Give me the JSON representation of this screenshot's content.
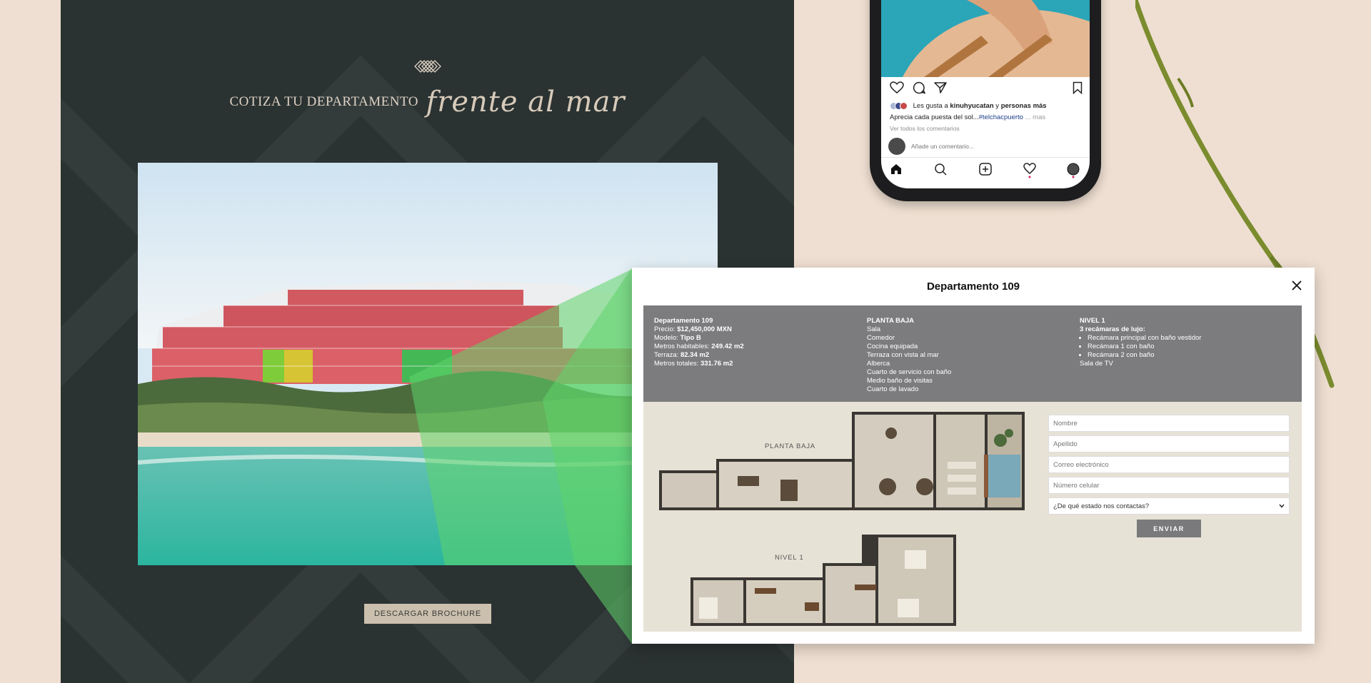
{
  "landing": {
    "headline_plain": "COTIZA TU DEPARTAMENTO",
    "headline_script": "frente al mar",
    "brochure_label": "DESCARGAR BROCHURE"
  },
  "phone": {
    "likes_prefix": "Les gusta a",
    "likes_user": "kinuhyucatan",
    "likes_connector": "y",
    "likes_suffix": "personas más",
    "caption_text": "Aprecia cada puesta del sol...",
    "caption_tag": "#telchacpuerto",
    "caption_more": "... mas",
    "view_all": "Ver todos los comentarios",
    "comment_placeholder": "Añade un comentario..."
  },
  "modal": {
    "title": "Departamento 109",
    "details": {
      "name": "Departamento 109",
      "price_label": "Precio:",
      "price_value": "$12,450,000 MXN",
      "model_label": "Modelo:",
      "model_value": "Tipo B",
      "habitable_label": "Metros habitables:",
      "habitable_value": "249.42 m2",
      "terrace_label": "Terraza:",
      "terrace_value": "82.34 m2",
      "total_label": "Metros totales:",
      "total_value": "331.76 m2"
    },
    "planta_baja": {
      "heading": "PLANTA BAJA",
      "items": [
        "Sala",
        "Comedor",
        "Cocina equipada",
        "Terraza con vista al mar",
        "Alberca",
        "Cuarto de servicio con baño",
        "Medio baño de visitas",
        "Cuarto de lavado"
      ]
    },
    "nivel1": {
      "heading": "NIVEL 1",
      "subheading": "3 recámaras de lujo:",
      "bullets": [
        "Recámara principal con baño vestidor",
        "Recámara 1 con baño",
        "Recámara 2 con baño"
      ],
      "extra": "Sala de TV"
    },
    "plan_labels": {
      "ground": "PLANTA BAJA",
      "level1": "NIVEL 1"
    },
    "form": {
      "nombre": "Nombre",
      "apellido": "Apellido",
      "correo": "Correo electrónico",
      "celular": "Número celular",
      "estado_select": "¿De qué estado nos contactas?",
      "send_label": "ENVIAR"
    }
  },
  "colors": {
    "landing_bg": "#2b3232",
    "page_bg": "#efdfd2",
    "accent_sand": "#cbc0ad",
    "info_gray": "#7c7c7e",
    "highlight_green": "#5fd36a",
    "building_red": "#d9474f"
  }
}
